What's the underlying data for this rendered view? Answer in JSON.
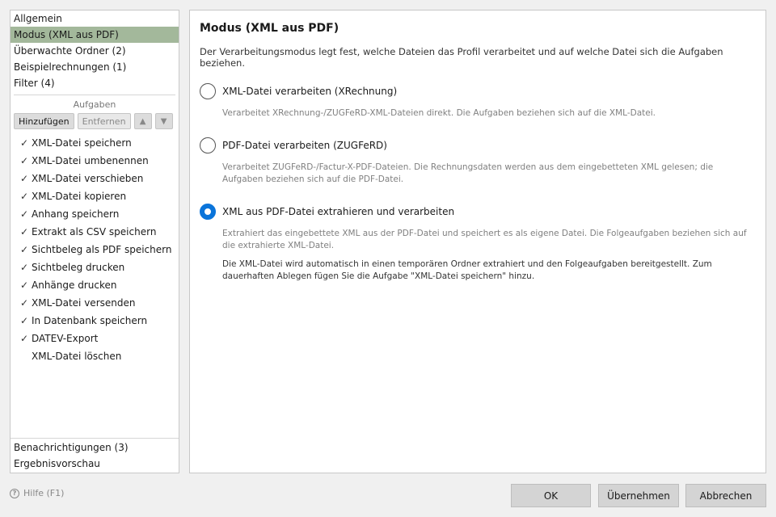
{
  "sidebar": {
    "top_items": [
      {
        "label": "Allgemein"
      },
      {
        "label": "Modus (XML aus PDF)"
      },
      {
        "label": "Überwachte Ordner (2)"
      },
      {
        "label": "Beispielrechnungen (1)"
      },
      {
        "label": "Filter (4)"
      }
    ],
    "tasks_header": "Aufgaben",
    "toolbar": {
      "add_label": "Hinzufügen",
      "remove_label": "Entfernen",
      "up_label": "▲",
      "down_label": "▼"
    },
    "tasks": [
      {
        "check": "✓",
        "label": "XML-Datei speichern"
      },
      {
        "check": "✓",
        "label": "XML-Datei umbenennen"
      },
      {
        "check": "✓",
        "label": "XML-Datei verschieben"
      },
      {
        "check": "✓",
        "label": "XML-Datei kopieren"
      },
      {
        "check": "✓",
        "label": "Anhang speichern"
      },
      {
        "check": "✓",
        "label": "Extrakt als CSV speichern"
      },
      {
        "check": "✓",
        "label": "Sichtbeleg als PDF speichern"
      },
      {
        "check": "✓",
        "label": "Sichtbeleg drucken"
      },
      {
        "check": "✓",
        "label": "Anhänge drucken"
      },
      {
        "check": "✓",
        "label": "XML-Datei versenden"
      },
      {
        "check": "✓",
        "label": "In Datenbank speichern"
      },
      {
        "check": "✓",
        "label": "DATEV-Export"
      },
      {
        "check": "",
        "label": "XML-Datei löschen"
      }
    ],
    "bottom_items": [
      {
        "label": "Benachrichtigungen (3)"
      },
      {
        "label": "Ergebnisvorschau"
      }
    ]
  },
  "content": {
    "title": "Modus (XML aus PDF)",
    "description": "Der Verarbeitungsmodus legt fest, welche Dateien das Profil verarbeitet und auf welche Datei sich die Aufgaben beziehen.",
    "options": [
      {
        "label": "XML-Datei verarbeiten (XRechnung)",
        "desc": "Verarbeitet XRechnung-/ZUGFeRD-XML-Dateien direkt. Die Aufgaben beziehen sich auf die XML-Datei."
      },
      {
        "label": "PDF-Datei verarbeiten (ZUGFeRD)",
        "desc": "Verarbeitet ZUGFeRD-/Factur-X-PDF-Dateien. Die Rechnungsdaten werden aus dem eingebetteten XML gelesen; die Aufgaben beziehen sich auf die PDF-Datei."
      },
      {
        "label": "XML aus PDF-Datei extrahieren und verarbeiten",
        "desc": "Extrahiert das eingebettete XML aus der PDF-Datei und speichert es als eigene Datei. Die Folgeaufgaben beziehen sich auf die extrahierte XML-Datei.",
        "desc2": "Die XML-Datei wird automatisch in einen temporären Ordner extrahiert und den Folgeaufgaben bereitgestellt. Zum dauerhaften Ablegen fügen Sie die Aufgabe \"XML-Datei speichern\" hinzu."
      }
    ],
    "selected_option": 2
  },
  "footer": {
    "help_label": "Hilfe (F1)",
    "help_icon": "question-icon",
    "ok_label": "OK",
    "apply_label": "Übernehmen",
    "cancel_label": "Abbrechen"
  },
  "colors": {
    "selection": "#a3b89b",
    "accent": "#0a74da"
  }
}
